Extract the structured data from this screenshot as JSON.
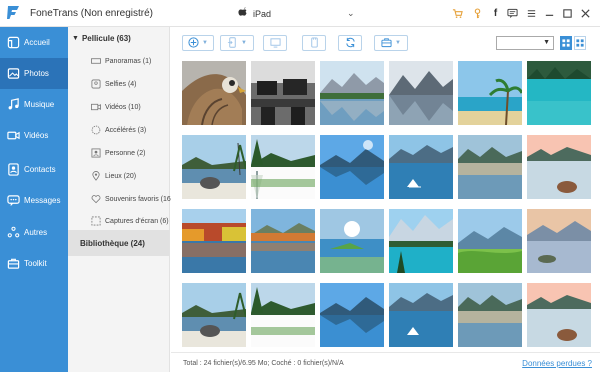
{
  "app": {
    "title": "FoneTrans (Non enregistré)",
    "device_name": "iPad",
    "accent_color": "#3a8fd6",
    "active_color": "#2b73b8"
  },
  "titlebar_icons": [
    "cart-icon",
    "key-icon",
    "facebook-icon",
    "chat-icon",
    "menu-icon",
    "minimize-icon",
    "maximize-icon",
    "close-icon"
  ],
  "sidebar": {
    "items": [
      {
        "label": "Accueil",
        "icon": "home-icon"
      },
      {
        "label": "Photos",
        "icon": "photo-icon",
        "active": true
      },
      {
        "label": "Musique",
        "icon": "music-icon"
      },
      {
        "label": "Vidéos",
        "icon": "video-icon"
      },
      {
        "label": "Contacts",
        "icon": "contacts-icon"
      },
      {
        "label": "Messages",
        "icon": "messages-icon"
      },
      {
        "label": "Autres",
        "icon": "others-icon"
      },
      {
        "label": "Toolkit",
        "icon": "toolkit-icon"
      }
    ]
  },
  "tree": {
    "header": "Pellicule (63)",
    "items": [
      {
        "label": "Panoramas (1)",
        "icon": "panorama-icon"
      },
      {
        "label": "Selfies (4)",
        "icon": "selfie-icon"
      },
      {
        "label": "Vidéos (10)",
        "icon": "video-icon"
      },
      {
        "label": "Accélérés (3)",
        "icon": "timelapse-icon"
      },
      {
        "label": "Personne (2)",
        "icon": "person-icon"
      },
      {
        "label": "Lieux (20)",
        "icon": "location-icon"
      },
      {
        "label": "Souvenirs favoris (16",
        "icon": "heart-icon"
      },
      {
        "label": "Captures d'écran (6)",
        "icon": "screenshot-icon"
      }
    ],
    "library": "Bibliothèque (24)"
  },
  "toolbar": {
    "buttons": [
      "add-icon",
      "export-device-icon",
      "export-pc-icon",
      "delete-icon",
      "refresh-icon",
      "toolbox-icon"
    ],
    "select_value": "",
    "views": [
      "grid-view-icon",
      "list-view-icon"
    ]
  },
  "photos": [
    {
      "scene": "eagle"
    },
    {
      "scene": "office"
    },
    {
      "scene": "lake-mountains"
    },
    {
      "scene": "misty-lake"
    },
    {
      "scene": "beach-palm"
    },
    {
      "scene": "turquoise-lake"
    },
    {
      "scene": "rocky-beach"
    },
    {
      "scene": "tree-lake"
    },
    {
      "scene": "mirror-lake"
    },
    {
      "scene": "blue-lake"
    },
    {
      "scene": "sunset-lake"
    },
    {
      "scene": "rock-water"
    },
    {
      "scene": "autumn-lake"
    },
    {
      "scene": "mirror-lake-2"
    },
    {
      "scene": "green-island"
    },
    {
      "scene": "turquoise-mountain"
    },
    {
      "scene": "green-hills"
    },
    {
      "scene": "glowing-sky"
    },
    {
      "scene": "rocky-beach"
    },
    {
      "scene": "tree-lake"
    },
    {
      "scene": "mirror-lake"
    },
    {
      "scene": "blue-lake"
    },
    {
      "scene": "sunset-lake"
    },
    {
      "scene": "rock-water"
    }
  ],
  "footer": {
    "status": "Total : 24 fichier(s)/6.95 Mo; Coché : 0 fichier(s)/N/A",
    "link": "Données perdues ?"
  }
}
